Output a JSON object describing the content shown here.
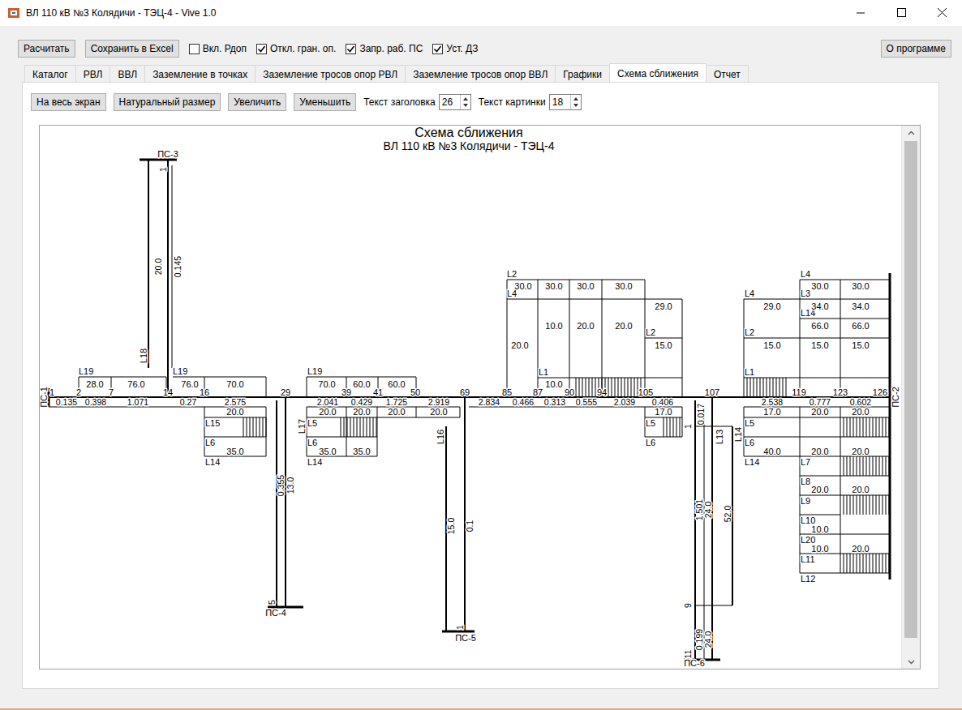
{
  "window": {
    "title": "ВЛ 110 кВ №3 Колядичи - ТЭЦ-4 - Vive 1.0"
  },
  "toolbar": {
    "buttons": [
      "Расчитать",
      "Сохранить в Excel"
    ],
    "checkboxes": [
      {
        "label": "Вкл. Рдоп",
        "checked": false
      },
      {
        "label": "Откл. гран. оп.",
        "checked": true
      },
      {
        "label": "Запр. раб. ПС",
        "checked": true
      },
      {
        "label": "Уст. ДЗ",
        "checked": true
      }
    ],
    "about": "О программе"
  },
  "tabs": [
    {
      "label": "Каталог",
      "selected": false
    },
    {
      "label": "РВЛ",
      "selected": false
    },
    {
      "label": "ВВЛ",
      "selected": false
    },
    {
      "label": "Заземление в точках",
      "selected": false
    },
    {
      "label": "Заземление тросов опор РВЛ",
      "selected": false
    },
    {
      "label": "Заземление тросов опор ВВЛ",
      "selected": false
    },
    {
      "label": "Графики",
      "selected": false
    },
    {
      "label": "Схема сближения",
      "selected": true
    },
    {
      "label": "Отчет",
      "selected": false
    }
  ],
  "view_toolbar": {
    "buttons": [
      "На весь экран",
      "Натуральный размер",
      "Увеличить",
      "Уменьшить"
    ],
    "spinners": [
      {
        "label": "Текст заголовка",
        "value": "26"
      },
      {
        "label": "Текст картинки",
        "value": "18"
      }
    ]
  },
  "diagram": {
    "title": "Схема сближения",
    "subtitle": "ВЛ 110 кВ №3 Колядичи - ТЭЦ-4",
    "substations": [
      "ПС-1",
      "ПС-2",
      "ПС-3",
      "ПС-4",
      "ПС-5",
      "ПС-6"
    ],
    "towers": [
      "1",
      "2",
      "7",
      "14",
      "16",
      "29",
      "39",
      "41",
      "50",
      "69",
      "85",
      "87",
      "90",
      "94",
      "105",
      "107",
      "119",
      "123",
      "126"
    ],
    "spans": [
      "0.135",
      "0.398",
      "1.071",
      "0.27",
      "2.575",
      "2.041",
      "0.429",
      "1.725",
      "2.919",
      "2.834",
      "0.466",
      "0.313",
      "0.555",
      "2.039",
      "0.406",
      "2.538",
      "0.777",
      "0.602"
    ],
    "line_names": [
      "L19",
      "L19",
      "L15",
      "L6",
      "L14",
      "L19",
      "L5",
      "L6",
      "L14",
      "L2",
      "L4",
      "L1",
      "L2",
      "L5",
      "L6",
      "L4",
      "L4",
      "L3",
      "L14",
      "L2",
      "L1",
      "L5",
      "L6",
      "L14",
      "L7",
      "L8",
      "L9",
      "L10",
      "L20",
      "L11",
      "L12",
      "L18",
      "L17",
      "L16",
      "L13",
      "L14"
    ],
    "distances": [
      "28.0",
      "76.0",
      "76.0",
      "70.0",
      "20.0",
      "35.0",
      "70.0",
      "60.0",
      "60.0",
      "20.0",
      "20.0",
      "20.0",
      "20.0",
      "35.0",
      "35.0",
      "30.0",
      "30.0",
      "30.0",
      "30.0",
      "29.0",
      "10.0",
      "20.0",
      "20.0",
      "20.0",
      "15.0",
      "10.0",
      "17.0",
      "30.0",
      "30.0",
      "29.0",
      "34.0",
      "34.0",
      "66.0",
      "66.0",
      "15.0",
      "15.0",
      "15.0",
      "17.0",
      "20.0",
      "20.0",
      "40.0",
      "20.0",
      "20.0",
      "20.0",
      "20.0",
      "10.0",
      "10.0",
      "20.0"
    ],
    "branch_marks": [
      "1",
      "20.0",
      "0.145",
      "0.355",
      "13.0",
      "5",
      "15.0",
      "0.1",
      "1",
      "1",
      "0.017",
      "1.501",
      "24.0",
      "52.0",
      "9",
      "0.199",
      "24.0",
      "11"
    ]
  },
  "scrollbar": {
    "level": 0.97
  }
}
